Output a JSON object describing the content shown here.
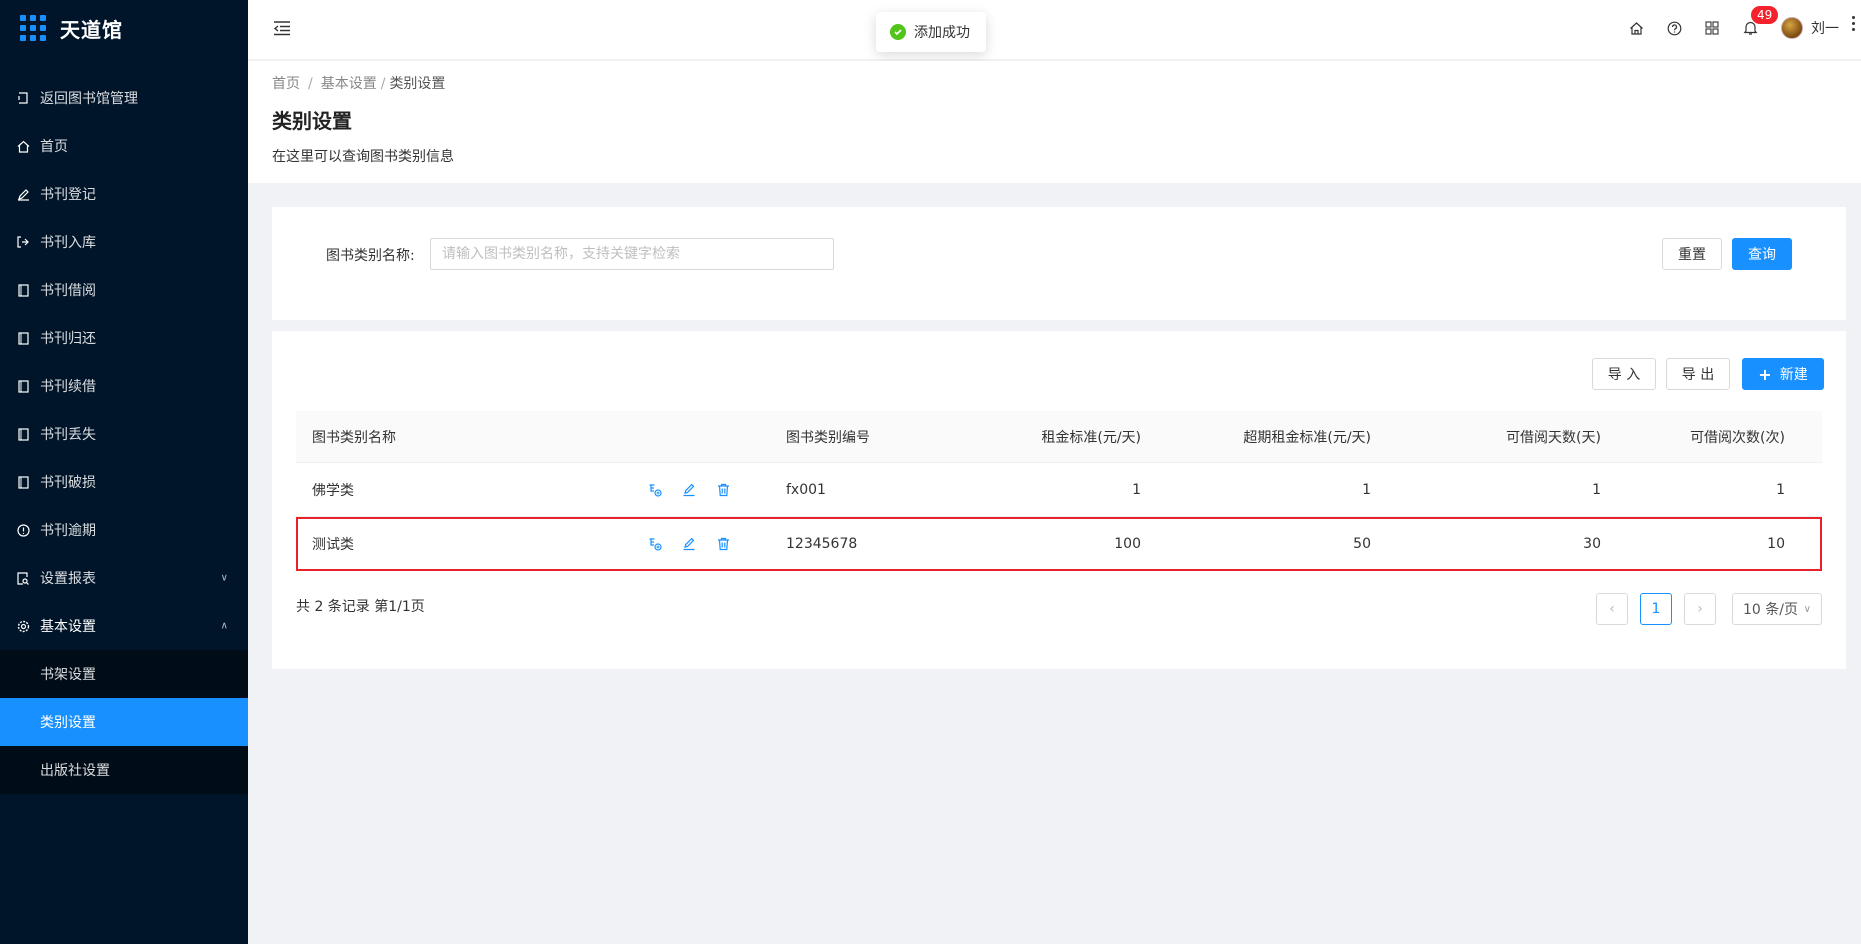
{
  "app": {
    "title": "天道馆"
  },
  "sidebar": {
    "items": [
      {
        "label": "返回图书馆管理",
        "icon": "back-icon"
      },
      {
        "label": "首页",
        "icon": "home-icon"
      },
      {
        "label": "书刊登记",
        "icon": "pen-icon"
      },
      {
        "label": "书刊入库",
        "icon": "import-icon"
      },
      {
        "label": "书刊借阅",
        "icon": "book-icon"
      },
      {
        "label": "书刊归还",
        "icon": "book-icon"
      },
      {
        "label": "书刊续借",
        "icon": "book-icon"
      },
      {
        "label": "书刊丢失",
        "icon": "book-icon"
      },
      {
        "label": "书刊破损",
        "icon": "book-icon"
      },
      {
        "label": "书刊逾期",
        "icon": "info-icon"
      },
      {
        "label": "设置报表",
        "icon": "report-icon"
      },
      {
        "label": "基本设置",
        "icon": "gear-icon"
      }
    ],
    "submenu": [
      {
        "label": "书架设置"
      },
      {
        "label": "类别设置"
      },
      {
        "label": "出版社设置"
      }
    ]
  },
  "header": {
    "toast": "添加成功",
    "notifications": "49",
    "username": "刘一"
  },
  "page": {
    "breadcrumb": [
      "首页",
      "基本设置",
      "类别设置"
    ],
    "title": "类别设置",
    "description": "在这里可以查询图书类别信息"
  },
  "search": {
    "label": "图书类别名称:",
    "placeholder": "请输入图书类别名称，支持关键字检索",
    "reset": "重置",
    "query": "查询"
  },
  "toolbar": {
    "import": "导 入",
    "export": "导 出",
    "new": "新建"
  },
  "table": {
    "headers": {
      "name": "图书类别名称",
      "code": "图书类别编号",
      "rent": "租金标准(元/天)",
      "overdue": "超期租金标准(元/天)",
      "days": "可借阅天数(天)",
      "times": "可借阅次数(次)"
    },
    "rows": [
      {
        "name": "佛学类",
        "code": "fx001",
        "rent": "1",
        "overdue": "1",
        "days": "1",
        "times": "1"
      },
      {
        "name": "测试类",
        "code": "12345678",
        "rent": "100",
        "overdue": "50",
        "days": "30",
        "times": "10"
      }
    ]
  },
  "pagination": {
    "summary": "共 2 条记录 第1/1页",
    "current": "1",
    "page_size": "10 条/页"
  },
  "colors": {
    "accent": "#1890ff",
    "sidebar_bg": "#001529",
    "highlight": "#e8222a",
    "success": "#52c41a"
  }
}
